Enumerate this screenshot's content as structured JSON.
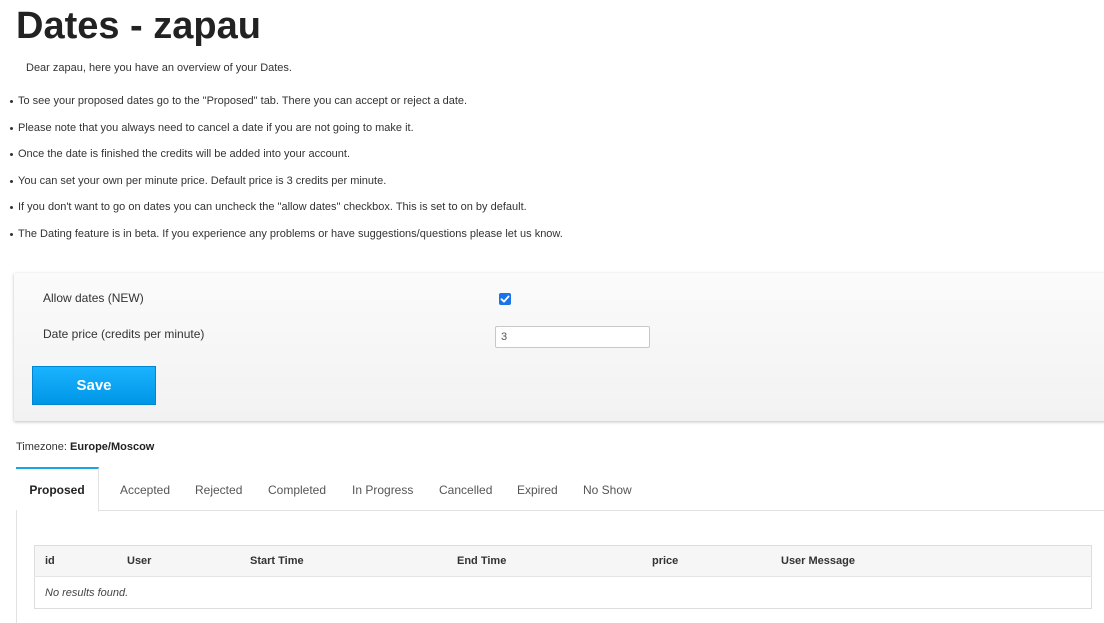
{
  "page": {
    "title": "Dates - zapau",
    "intro": "Dear zapau, here you have an overview of your Dates."
  },
  "info_bullets": [
    "To see your proposed dates go to the \"Proposed\" tab. There you can accept or reject a date.",
    "Please note that you always need to cancel a date if you are not going to make it.",
    "Once the date is finished the credits will be added into your account.",
    "You can set your own per minute price. Default price is 3 credits per minute.",
    "If you don't want to go on dates you can uncheck the \"allow dates\" checkbox. This is set to on by default.",
    "The Dating feature is in beta. If you experience any problems or have suggestions/questions please let us know."
  ],
  "settings": {
    "allow_dates_label": "Allow dates (NEW)",
    "allow_dates_checked": true,
    "price_label": "Date price (credits per minute)",
    "price_value": "3",
    "save_label": "Save"
  },
  "timezone": {
    "label": "Timezone:",
    "value": "Europe/Moscow"
  },
  "tabs": [
    {
      "label": "Proposed",
      "active": true
    },
    {
      "label": "Accepted",
      "active": false
    },
    {
      "label": "Rejected",
      "active": false
    },
    {
      "label": "Completed",
      "active": false
    },
    {
      "label": "In Progress",
      "active": false
    },
    {
      "label": "Cancelled",
      "active": false
    },
    {
      "label": "Expired",
      "active": false
    },
    {
      "label": "No Show",
      "active": false
    }
  ],
  "table": {
    "columns": [
      "id",
      "User",
      "Start Time",
      "End Time",
      "price",
      "User Message"
    ],
    "empty_message": "No results found."
  },
  "colors": {
    "accent": "#1aa3e8",
    "checkbox": "#1a73e8",
    "button_top": "#1ab3ff",
    "button_bottom": "#0096e6"
  }
}
